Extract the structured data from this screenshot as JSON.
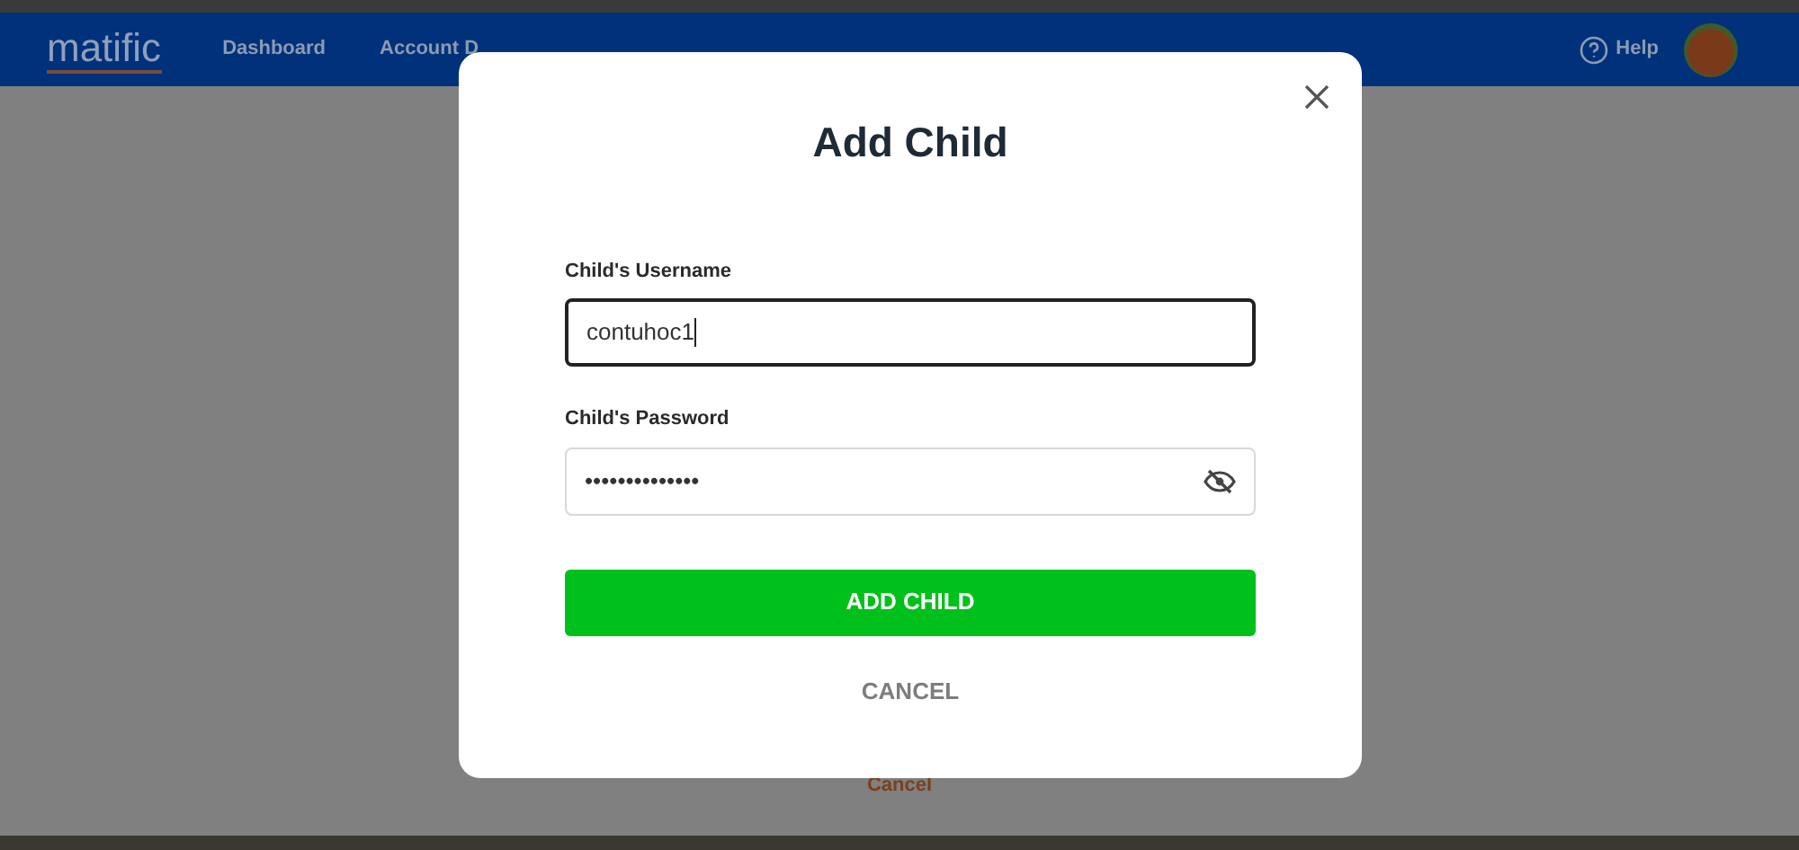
{
  "navbar": {
    "logo": "matific",
    "links": [
      {
        "label": "Dashboard"
      },
      {
        "label": "Account D"
      }
    ],
    "help": "Help"
  },
  "page": {
    "cancel_link": "Cancel"
  },
  "dialog": {
    "title": "Add Child",
    "fields": [
      {
        "label": "Child's Username",
        "value": "contuhoc1",
        "kind": "text",
        "focused": true
      },
      {
        "label": "Child's Password",
        "value": "••••••••••••••",
        "kind": "password",
        "focused": false
      }
    ],
    "submit": "ADD CHILD",
    "cancel": "CANCEL"
  }
}
